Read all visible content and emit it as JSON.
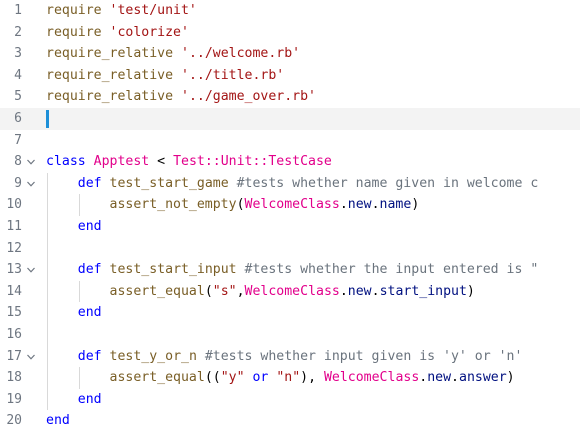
{
  "editor": {
    "colors": {
      "method": "#795e26",
      "string": "#a31515",
      "keyword": "#0000ff",
      "class": "#e2008b",
      "comment": "#6a737d",
      "gutter": "#6e7681",
      "cursor": "#1d8fd8",
      "current_line": "#f3f3f3"
    },
    "lines": [
      {
        "n": "1",
        "fold": "",
        "tokens": [
          {
            "t": "require",
            "c": "method"
          },
          {
            "t": " ",
            "c": "plain"
          },
          {
            "t": "'test/unit'",
            "c": "string"
          }
        ]
      },
      {
        "n": "2",
        "fold": "",
        "tokens": [
          {
            "t": "require",
            "c": "method"
          },
          {
            "t": " ",
            "c": "plain"
          },
          {
            "t": "'colorize'",
            "c": "string"
          }
        ]
      },
      {
        "n": "3",
        "fold": "",
        "tokens": [
          {
            "t": "require_relative",
            "c": "method"
          },
          {
            "t": " ",
            "c": "plain"
          },
          {
            "t": "'../welcome.rb'",
            "c": "string"
          }
        ]
      },
      {
        "n": "4",
        "fold": "",
        "tokens": [
          {
            "t": "require_relative",
            "c": "method"
          },
          {
            "t": " ",
            "c": "plain"
          },
          {
            "t": "'../title.rb'",
            "c": "string"
          }
        ]
      },
      {
        "n": "5",
        "fold": "",
        "tokens": [
          {
            "t": "require_relative",
            "c": "method"
          },
          {
            "t": " ",
            "c": "plain"
          },
          {
            "t": "'../game_over.rb'",
            "c": "string"
          }
        ]
      },
      {
        "n": "6",
        "fold": "",
        "current": true,
        "tokens": []
      },
      {
        "n": "7",
        "fold": "",
        "tokens": []
      },
      {
        "n": "8",
        "fold": "v",
        "tokens": [
          {
            "t": "class",
            "c": "keyword"
          },
          {
            "t": " ",
            "c": "plain"
          },
          {
            "t": "Apptest",
            "c": "class"
          },
          {
            "t": " < ",
            "c": "plain"
          },
          {
            "t": "Test::Unit::TestCase",
            "c": "class"
          }
        ]
      },
      {
        "n": "9",
        "fold": "v",
        "tokens": [
          {
            "t": "    ",
            "c": "plain"
          },
          {
            "t": "def",
            "c": "keyword"
          },
          {
            "t": " ",
            "c": "plain"
          },
          {
            "t": "test_start_game",
            "c": "method"
          },
          {
            "t": " #tests whether name given in welcome c",
            "c": "comment"
          }
        ]
      },
      {
        "n": "10",
        "fold": "",
        "tokens": [
          {
            "t": "        ",
            "c": "plain"
          },
          {
            "t": "assert_not_empty",
            "c": "method"
          },
          {
            "t": "(",
            "c": "plain"
          },
          {
            "t": "WelcomeClass",
            "c": "class"
          },
          {
            "t": ".",
            "c": "plain"
          },
          {
            "t": "new",
            "c": "call"
          },
          {
            "t": ".",
            "c": "plain"
          },
          {
            "t": "name",
            "c": "call"
          },
          {
            "t": ")",
            "c": "plain"
          }
        ]
      },
      {
        "n": "11",
        "fold": "",
        "tokens": [
          {
            "t": "    ",
            "c": "plain"
          },
          {
            "t": "end",
            "c": "keyword"
          }
        ]
      },
      {
        "n": "12",
        "fold": "",
        "tokens": []
      },
      {
        "n": "13",
        "fold": "v",
        "tokens": [
          {
            "t": "    ",
            "c": "plain"
          },
          {
            "t": "def",
            "c": "keyword"
          },
          {
            "t": " ",
            "c": "plain"
          },
          {
            "t": "test_start_input",
            "c": "method"
          },
          {
            "t": " #tests whether the input entered is \"",
            "c": "comment"
          }
        ]
      },
      {
        "n": "14",
        "fold": "",
        "tokens": [
          {
            "t": "        ",
            "c": "plain"
          },
          {
            "t": "assert_equal",
            "c": "method"
          },
          {
            "t": "(",
            "c": "plain"
          },
          {
            "t": "\"s\"",
            "c": "string"
          },
          {
            "t": ",",
            "c": "plain"
          },
          {
            "t": "WelcomeClass",
            "c": "class"
          },
          {
            "t": ".",
            "c": "plain"
          },
          {
            "t": "new",
            "c": "call"
          },
          {
            "t": ".",
            "c": "plain"
          },
          {
            "t": "start_input",
            "c": "call"
          },
          {
            "t": ")",
            "c": "plain"
          }
        ]
      },
      {
        "n": "15",
        "fold": "",
        "tokens": [
          {
            "t": "    ",
            "c": "plain"
          },
          {
            "t": "end",
            "c": "keyword"
          }
        ]
      },
      {
        "n": "16",
        "fold": "",
        "tokens": []
      },
      {
        "n": "17",
        "fold": "v",
        "tokens": [
          {
            "t": "    ",
            "c": "plain"
          },
          {
            "t": "def",
            "c": "keyword"
          },
          {
            "t": " ",
            "c": "plain"
          },
          {
            "t": "test_y_or_n",
            "c": "method"
          },
          {
            "t": " #tests whether input given is 'y' or 'n'",
            "c": "comment"
          }
        ]
      },
      {
        "n": "18",
        "fold": "",
        "tokens": [
          {
            "t": "        ",
            "c": "plain"
          },
          {
            "t": "assert_equal",
            "c": "method"
          },
          {
            "t": "((",
            "c": "plain"
          },
          {
            "t": "\"y\"",
            "c": "string"
          },
          {
            "t": " ",
            "c": "plain"
          },
          {
            "t": "or",
            "c": "keyword"
          },
          {
            "t": " ",
            "c": "plain"
          },
          {
            "t": "\"n\"",
            "c": "string"
          },
          {
            "t": "), ",
            "c": "plain"
          },
          {
            "t": "WelcomeClass",
            "c": "class"
          },
          {
            "t": ".",
            "c": "plain"
          },
          {
            "t": "new",
            "c": "call"
          },
          {
            "t": ".",
            "c": "plain"
          },
          {
            "t": "answer",
            "c": "call"
          },
          {
            "t": ")",
            "c": "plain"
          }
        ]
      },
      {
        "n": "19",
        "fold": "",
        "tokens": [
          {
            "t": "    ",
            "c": "plain"
          },
          {
            "t": "end",
            "c": "keyword"
          }
        ]
      },
      {
        "n": "20",
        "fold": "",
        "tokens": [
          {
            "t": "end",
            "c": "keyword"
          }
        ]
      }
    ]
  }
}
